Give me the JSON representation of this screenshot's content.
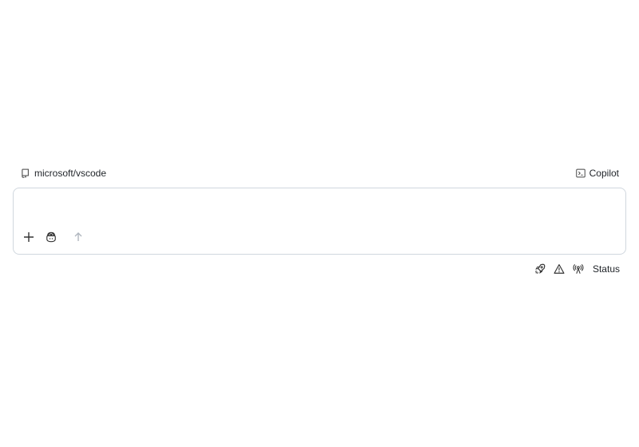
{
  "repo": {
    "name": "microsoft/vscode",
    "icon": "repo-icon"
  },
  "agent": {
    "label": "Copilot",
    "icon": "terminal-icon"
  },
  "composer": {
    "placeholder": "",
    "value": "",
    "add_icon": "plus-icon",
    "copilot_icon": "copilot-icon",
    "send_icon": "arrow-up-icon"
  },
  "statusbar": {
    "icons": [
      "rocket-icon",
      "warning-icon",
      "broadcast-icon"
    ],
    "label": "Status"
  },
  "colors": {
    "border": "#d0d7de",
    "text": "#1f2328",
    "disabled": "#b0b7bf"
  }
}
